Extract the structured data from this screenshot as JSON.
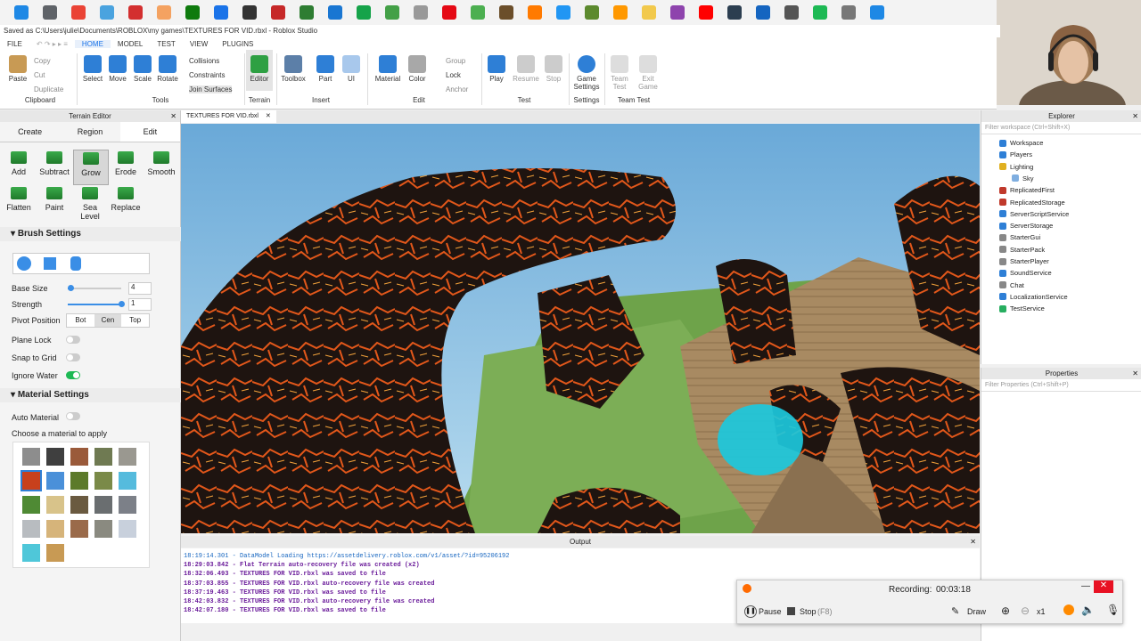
{
  "window": {
    "title": "Saved as C:\\Users\\julie\\Documents\\ROBLOX\\my games\\TEXTURES FOR VID.rbxl - Roblox Studio"
  },
  "menu": [
    "FILE",
    "HOME",
    "MODEL",
    "TEST",
    "VIEW",
    "PLUGINS"
  ],
  "ribbon": {
    "clipboard": {
      "paste": "Paste",
      "copy": "Copy",
      "cut": "Cut",
      "duplicate": "Duplicate",
      "group": "Clipboard"
    },
    "tools": {
      "select": "Select",
      "move": "Move",
      "scale": "Scale",
      "rotate": "Rotate",
      "collisions": "Collisions",
      "constraints": "Constraints",
      "join_surfaces": "Join Surfaces",
      "group": "Tools"
    },
    "terrain": {
      "editor": "Editor",
      "group": "Terrain"
    },
    "insert": {
      "toolbox": "Toolbox",
      "part": "Part",
      "ui": "UI",
      "group": "Insert"
    },
    "edit": {
      "material": "Material",
      "color": "Color",
      "group_btn": "Group",
      "lock": "Lock",
      "anchor": "Anchor",
      "group": "Edit"
    },
    "test": {
      "play": "Play",
      "resume": "Resume",
      "stop": "Stop",
      "group": "Test"
    },
    "settings": {
      "game_settings_1": "Game",
      "game_settings_2": "Settings",
      "group": "Settings"
    },
    "team_test": {
      "team_test_1": "Team",
      "team_test_2": "Test",
      "exit_game_1": "Exit",
      "exit_game_2": "Game",
      "group": "Team Test"
    }
  },
  "terrain_editor": {
    "title": "Terrain Editor",
    "tabs": [
      "Create",
      "Region",
      "Edit"
    ],
    "tools": [
      "Add",
      "Subtract",
      "Grow",
      "Erode",
      "Smooth",
      "Flatten",
      "Paint",
      "Sea Level",
      "Replace"
    ],
    "selected_tool": "Grow",
    "brush_settings": "Brush Settings",
    "base_size_label": "Base Size",
    "base_size_value": "4",
    "base_size_fraction": 0.05,
    "strength_label": "Strength",
    "strength_value": "1",
    "strength_fraction": 1.0,
    "pivot_label": "Pivot Position",
    "pivot_options": [
      "Bot",
      "Cen",
      "Top"
    ],
    "pivot_selected": "Cen",
    "plane_lock": "Plane Lock",
    "snap_to_grid": "Snap to Grid",
    "ignore_water": "Ignore Water",
    "plane_lock_on": false,
    "snap_to_grid_on": false,
    "ignore_water_on": true,
    "material_settings": "Material Settings",
    "auto_material": "Auto Material",
    "auto_material_on": false,
    "choose_material": "Choose a material to apply",
    "material_colors": [
      "#8d8d8d",
      "#3f3f3f",
      "#9a5a3a",
      "#6f7a52",
      "#9a9890",
      "#c8401c",
      "#4a90d9",
      "#5c7a2a",
      "#7a8a48",
      "#55bbdd",
      "#4f8a34",
      "#d8c38a",
      "#6a5a40",
      "#6a6e70",
      "#7c8088",
      "#b8bcc0",
      "#d6b47a",
      "#9a6a4a",
      "#8a8a80",
      "#c8d0dc",
      "#4fc7d9",
      "#c89a54"
    ],
    "selected_material_index": 5
  },
  "viewport": {
    "tab": "TEXTURES FOR VID.rbxl"
  },
  "output": {
    "title": "Output",
    "lines": [
      {
        "text": "18:19:14.301 - DataModel Loading https://assetdelivery.roblox.com/v1/asset/?id=95206192",
        "kind": "info"
      },
      {
        "text": "18:29:03.842 - Flat Terrain auto-recovery file was created (x2)",
        "kind": "save"
      },
      {
        "text": "18:32:06.493 - TEXTURES FOR VID.rbxl was saved to file",
        "kind": "save"
      },
      {
        "text": "18:37:03.855 - TEXTURES FOR VID.rbxl auto-recovery file was created",
        "kind": "save"
      },
      {
        "text": "18:37:19.463 - TEXTURES FOR VID.rbxl was saved to file",
        "kind": "save"
      },
      {
        "text": "18:42:03.832 - TEXTURES FOR VID.rbxl auto-recovery file was created",
        "kind": "save"
      },
      {
        "text": "18:42:07.180 - TEXTURES FOR VID.rbxl was saved to file",
        "kind": "save"
      }
    ]
  },
  "explorer": {
    "title": "Explorer",
    "filter_placeholder": "Filter workspace (Ctrl+Shift+X)",
    "items": [
      {
        "label": "Workspace",
        "color": "#2e7fd6"
      },
      {
        "label": "Players",
        "color": "#2e7fd6"
      },
      {
        "label": "Lighting",
        "color": "#e0b020"
      },
      {
        "label": "Sky",
        "color": "#7faee0"
      },
      {
        "label": "ReplicatedFirst",
        "color": "#c0392b"
      },
      {
        "label": "ReplicatedStorage",
        "color": "#c0392b"
      },
      {
        "label": "ServerScriptService",
        "color": "#2e7fd6"
      },
      {
        "label": "ServerStorage",
        "color": "#2e7fd6"
      },
      {
        "label": "StarterGui",
        "color": "#888888"
      },
      {
        "label": "StarterPack",
        "color": "#888888"
      },
      {
        "label": "StarterPlayer",
        "color": "#888888"
      },
      {
        "label": "SoundService",
        "color": "#2e7fd6"
      },
      {
        "label": "Chat",
        "color": "#888888"
      },
      {
        "label": "LocalizationService",
        "color": "#2e7fd6"
      },
      {
        "label": "TestService",
        "color": "#27ae60"
      }
    ]
  },
  "properties": {
    "title": "Properties",
    "filter_placeholder": "Filter Properties (Ctrl+Shift+P)"
  },
  "recorder": {
    "recording_label": "Recording:",
    "time": "00:03:18",
    "pause": "Pause",
    "stop": "Stop",
    "stop_shortcut": "(F8)",
    "draw": "Draw",
    "zoom": "x1"
  },
  "taskbar_colors": [
    "#1e88e5",
    "#5f6368",
    "#ea4335",
    "#4aa3df",
    "#d32f2f",
    "#f4a261",
    "#0e7a0d",
    "#1a73e8",
    "#333333",
    "#c62828",
    "#2e7d32",
    "#1976d2",
    "#16a34a",
    "#43a047",
    "#999999",
    "#e50914",
    "#4caf50",
    "#6b4e2a",
    "#ff7a00",
    "#2196f3",
    "#5c8a2e",
    "#ff9800",
    "#f2c94c",
    "#8e44ad",
    "#ff0000",
    "#2c3e50",
    "#1565c0",
    "#555555",
    "#1db954",
    "#777777",
    "#1e88e5"
  ]
}
